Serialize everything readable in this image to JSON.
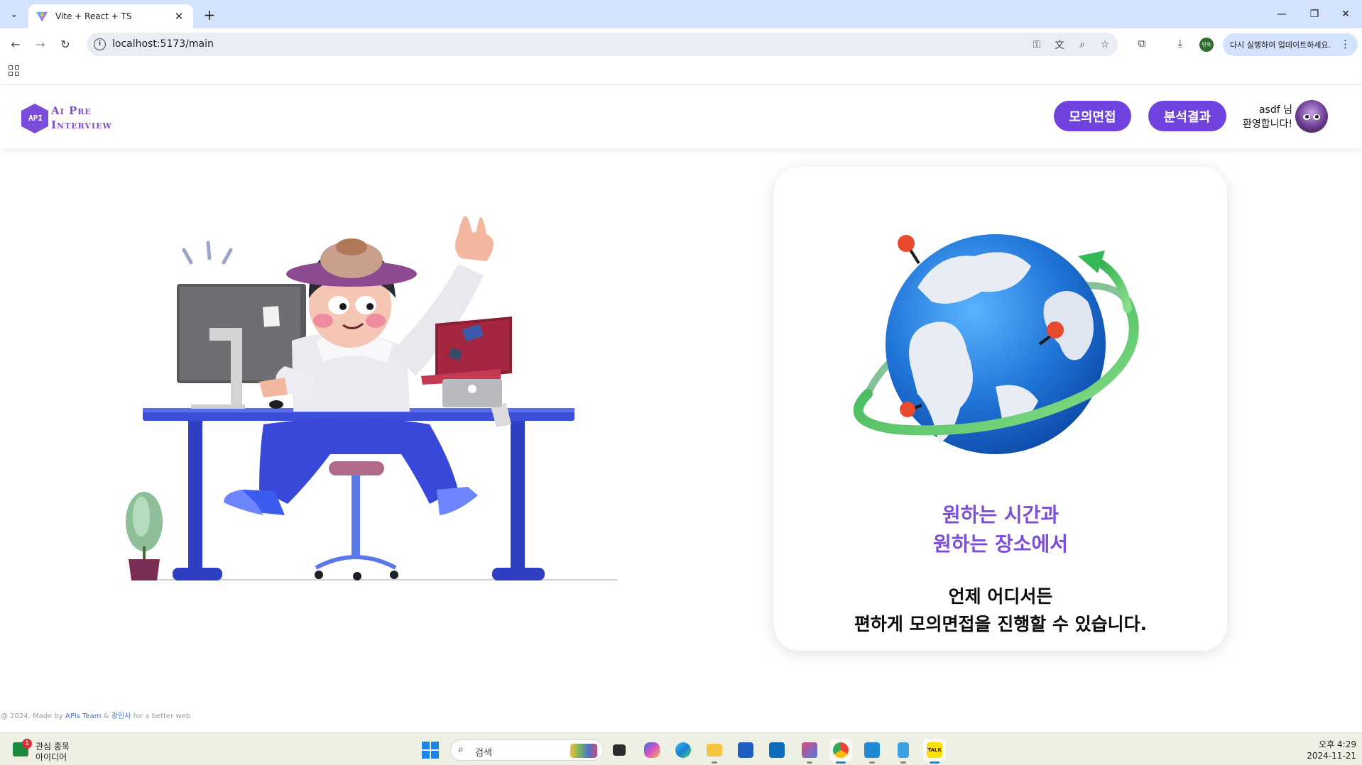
{
  "browser": {
    "tab_title": "Vite + React + TS",
    "url": "localhost:5173/main",
    "update_label": "다시 실행하여 업데이트하세요.",
    "profile_label": "민욱"
  },
  "header": {
    "logo_badge": "API",
    "logo_line1": "Ai Pre",
    "logo_line2": "Interview",
    "nav": [
      {
        "label": "모의면접"
      },
      {
        "label": "분석결과"
      }
    ],
    "user_name_line": "asdf 님",
    "welcome_line": "환영합니다!"
  },
  "card": {
    "headline_line1": "원하는 시간과",
    "headline_line2": "원하는 장소에서",
    "body_line1": "언제 어디서든",
    "body_line2": "편하게 모의면접을 진행할 수 있습니다."
  },
  "footer": {
    "prefix": "@ 2024, Made by ",
    "team": "APIs Team",
    "amp": " & ",
    "partner": "광인사",
    "suffix": " for a better web"
  },
  "taskbar": {
    "widget_badge": "1",
    "widget_line1": "관심 종목",
    "widget_line2": "아이디어",
    "search_placeholder": "검색",
    "kakao_label": "TALK",
    "clock_time": "오후 4:29",
    "clock_date": "2024-11-21"
  },
  "colors": {
    "brand_purple": "#7043e0",
    "headline_purple": "#7c4ddb",
    "chrome_blue": "#d3e3fd"
  },
  "icons": [
    "tab-search-icon",
    "vite-favicon",
    "close-icon",
    "plus-icon",
    "minimize-icon",
    "restore-icon",
    "window-close-icon",
    "back-icon",
    "forward-icon",
    "reload-icon",
    "site-info-icon",
    "password-key-icon",
    "translate-icon",
    "zoom-icon",
    "star-icon",
    "extensions-icon",
    "download-icon",
    "more-icon",
    "apps-grid-icon"
  ]
}
